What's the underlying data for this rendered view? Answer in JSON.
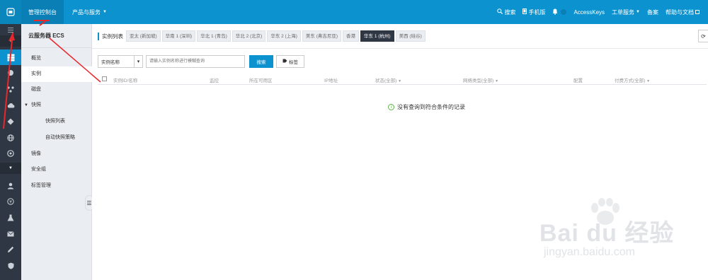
{
  "topbar": {
    "console": "管理控制台",
    "products": "产品与服务",
    "search": "搜索",
    "mobile": "手机版",
    "accesskeys": "AccessKeys",
    "ticket": "工单服务",
    "record": "备案",
    "help": "帮助与文档"
  },
  "nav": {
    "title": "云服务器 ECS",
    "items": [
      {
        "label": "概览"
      },
      {
        "label": "实例"
      },
      {
        "label": "磁盘"
      },
      {
        "label": "快照"
      },
      {
        "label": "快照列表"
      },
      {
        "label": "自动快照策略"
      },
      {
        "label": "镜像"
      },
      {
        "label": "安全组"
      },
      {
        "label": "标签管理"
      }
    ]
  },
  "regions": {
    "label": "实例列表",
    "tabs": [
      "亚太 (新加坡)",
      "华南 1 (深圳)",
      "华北 1 (青岛)",
      "华北 2 (北京)",
      "华东 2 (上海)",
      "美东 (弗吉尼亚)",
      "香港",
      "华东 1 (杭州)",
      "美西 (硅谷)"
    ],
    "active_index": 7
  },
  "filter": {
    "select_value": "实例名称",
    "placeholder": "请输入实例名称进行模糊查询",
    "search_button": "搜索",
    "tag_button": "标签"
  },
  "table": {
    "headers": [
      "实例ID/名称",
      "监控",
      "所在可用区",
      "IP地址",
      "状态(全部)",
      "网络类型(全部)",
      "配置",
      "付费方式(全部)"
    ]
  },
  "empty_message": "没有查询到符合条件的记录",
  "watermark": {
    "text": "Bai du 经验",
    "url": "jingyan.baidu.com"
  },
  "colors": {
    "topbar": "#0c93cf",
    "iconbar": "#2f3744",
    "annotation": "#e8272b"
  }
}
